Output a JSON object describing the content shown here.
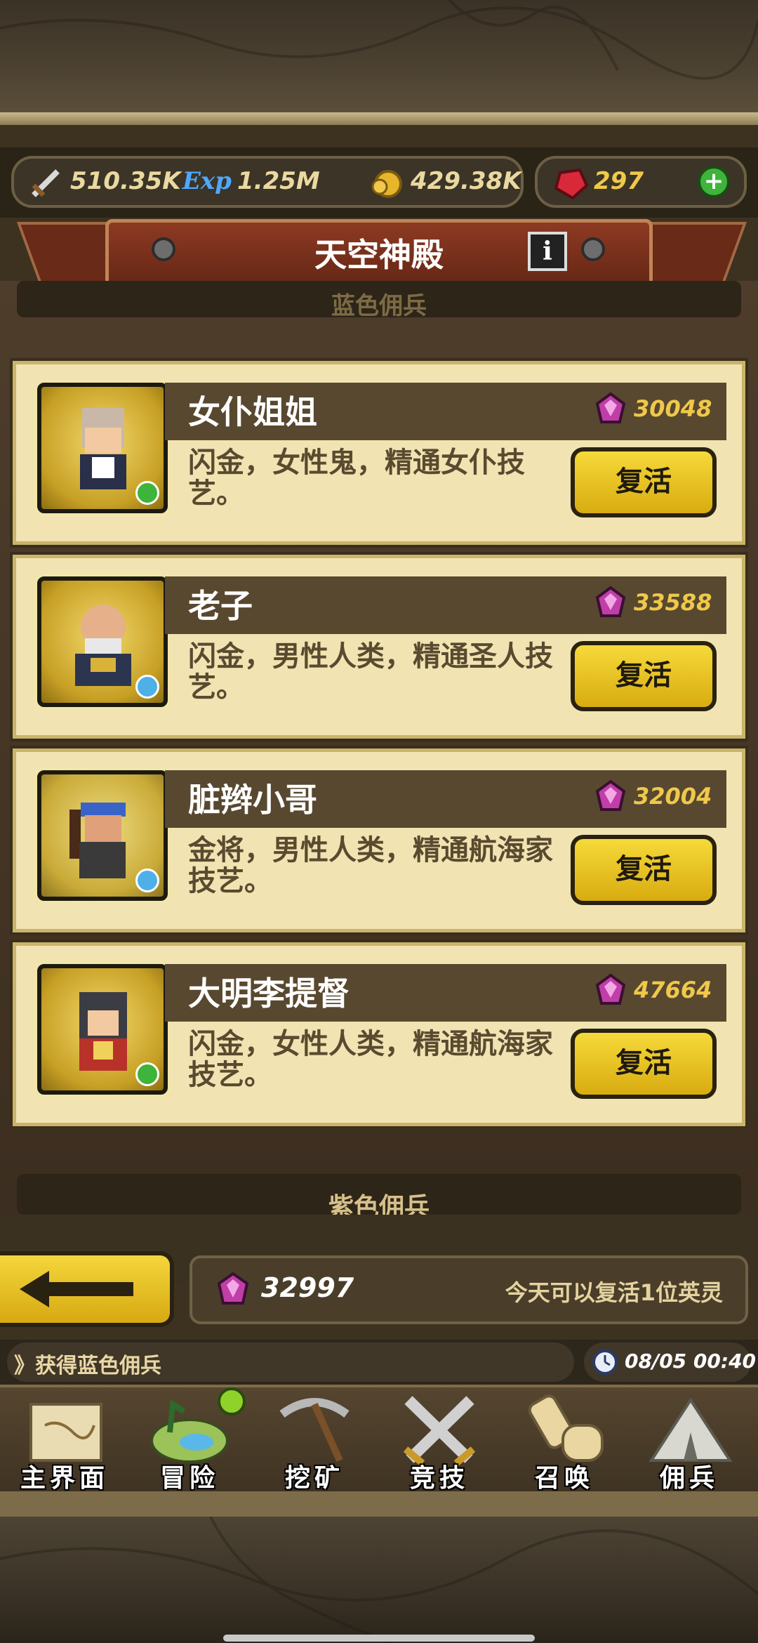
{
  "hud": {
    "attack": "510.35K",
    "exp_label": "Exp",
    "exp": "1.25M",
    "gold": "429.38K",
    "rubies": "297"
  },
  "header": {
    "title": "天空神殿",
    "info_label": "i"
  },
  "sections": {
    "top_label": "蓝色佣兵",
    "bottom_label": "紫色佣兵"
  },
  "mercenaries": [
    {
      "name": "女仆姐姐",
      "cost": "30048",
      "desc": "闪金，女性鬼，精通女仆技艺。",
      "button": "复活",
      "badge": "plus"
    },
    {
      "name": "老子",
      "cost": "33588",
      "desc": "闪金，男性人类，精通圣人技艺。",
      "button": "复活",
      "badge": "star"
    },
    {
      "name": "脏辫小哥",
      "cost": "32004",
      "desc": "金将，男性人类，精通航海家技艺。",
      "button": "复活",
      "badge": "star"
    },
    {
      "name": "大明李提督",
      "cost": "47664",
      "desc": "闪金，女性人类，精通航海家技艺。",
      "button": "复活",
      "badge": "plus"
    }
  ],
  "footer": {
    "gem_count": "32997",
    "revive_info": "今天可以复活1位英灵",
    "ticker": "》获得蓝色佣兵",
    "time": "08/05 00:40"
  },
  "nav": [
    {
      "label": "主界面",
      "icon": "map-scroll-icon"
    },
    {
      "label": "冒险",
      "icon": "island-icon"
    },
    {
      "label": "挖矿",
      "icon": "pickaxe-icon"
    },
    {
      "label": "竞技",
      "icon": "crossed-swords-icon"
    },
    {
      "label": "召唤",
      "icon": "summon-scroll-icon"
    },
    {
      "label": "佣兵",
      "icon": "tent-icon"
    }
  ],
  "colors": {
    "accent_yellow": "#f6d93a",
    "card_bg": "#f1e4b2",
    "gem_purple": "#c03ea8",
    "ruby": "#d8283a"
  }
}
